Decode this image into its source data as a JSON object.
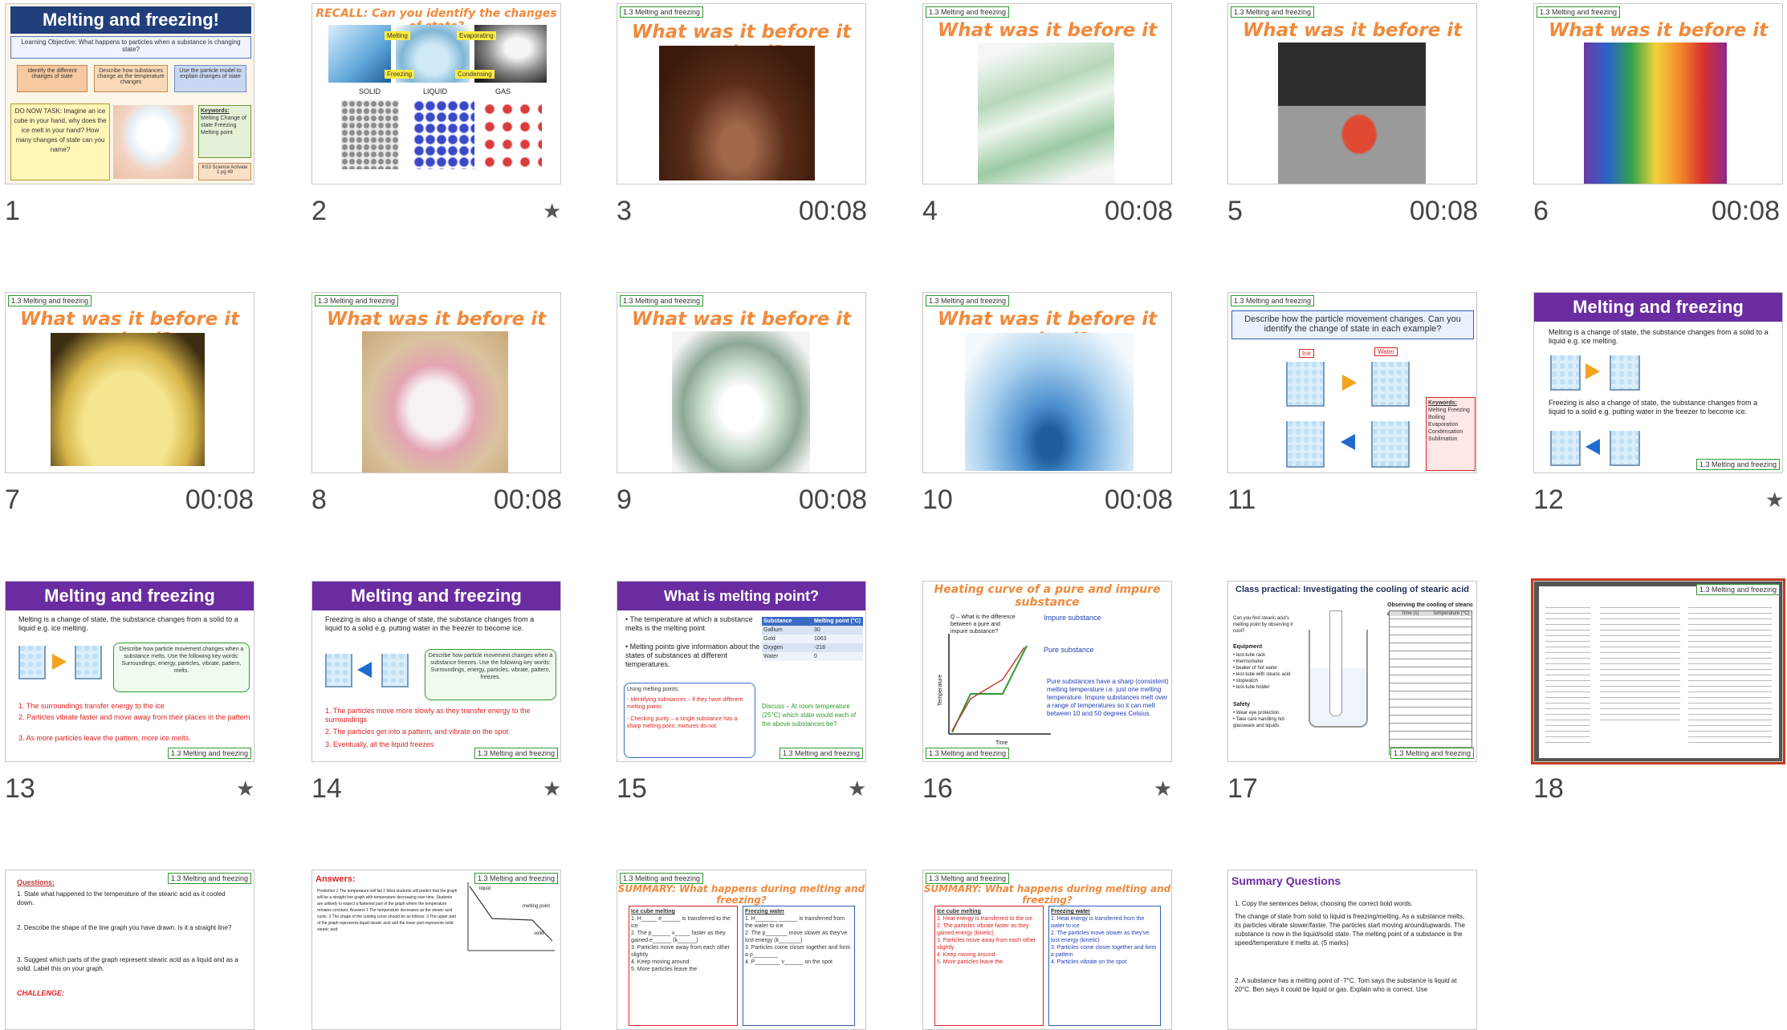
{
  "slides": [
    {
      "number": "1",
      "timing": "",
      "star": "",
      "title": "Melting and freezing!",
      "objective": "Learning Objective: What happens to particles when a substance is changing state?",
      "boxes": [
        "Identify the different changes of state",
        "Describe how substances change as the temperature changes",
        "Use the particle model to explain changes of state"
      ],
      "do_now": "DO NOW TASK: Imagine an ice cube in your hand, why does the ice melt in your hand? How many changes of state can you name?",
      "keywords_title": "Keywords:",
      "keywords": "Melting Change of state Freezing Melting point",
      "footer": "KS3 Science Activate 1 pg 49"
    },
    {
      "number": "2",
      "timing": "",
      "star": "★",
      "title": "RECALL: Can you identify the changes of state?",
      "labels": [
        "Melting",
        "Evaporating",
        "Freezing",
        "Condensing"
      ],
      "states": [
        "SOLID",
        "LIQUID",
        "GAS"
      ]
    },
    {
      "number": "3",
      "timing": "00:08",
      "star": "",
      "tag": "1.3 Melting and freezing",
      "title": "What was it before it melted?"
    },
    {
      "number": "4",
      "timing": "00:08",
      "star": "",
      "tag": "1.3 Melting and freezing",
      "title": "What was it before it melted?"
    },
    {
      "number": "5",
      "timing": "00:08",
      "star": "",
      "tag": "1.3 Melting and freezing",
      "title": "What was it before it melted?"
    },
    {
      "number": "6",
      "timing": "00:08",
      "star": "",
      "tag": "1.3 Melting and freezing",
      "title": "What was it before it melted?"
    },
    {
      "number": "7",
      "timing": "00:08",
      "star": "",
      "tag": "1.3 Melting and freezing",
      "title": "What was it before it melted?"
    },
    {
      "number": "8",
      "timing": "00:08",
      "star": "",
      "tag": "1.3 Melting and freezing",
      "title": "What was it before it melted?"
    },
    {
      "number": "9",
      "timing": "00:08",
      "star": "",
      "tag": "1.3 Melting and freezing",
      "title": "What was it before it melted?"
    },
    {
      "number": "10",
      "timing": "00:08",
      "star": "",
      "tag": "1.3 Melting and freezing",
      "title": "What was it before it melted?"
    },
    {
      "number": "11",
      "timing": "",
      "star": "",
      "tag": "1.3 Melting and freezing",
      "title": "Describe how the particle movement changes. Can you identify the change of state in each example?",
      "ice": "Ice",
      "water": "Water",
      "keywords_title": "Keywords:",
      "keywords": "Melting Freezing Boiling Evaporation Condensation Sublimation"
    },
    {
      "number": "12",
      "timing": "",
      "star": "★",
      "title": "Melting and freezing",
      "text1": "Melting is a change of state, the substance changes from a solid to a liquid e.g. ice melting.",
      "text2": "Freezing is also a change of state, the substance changes from a liquid to a solid e.g. putting water in the freezer to become ice.",
      "tag": "1.3 Melting and freezing"
    },
    {
      "number": "13",
      "timing": "",
      "star": "★",
      "title": "Melting and freezing",
      "text1": "Melting is a change of state, the substance changes from a solid to a liquid e.g. ice melting.",
      "green": "Describe how particle movement changes when a substance melts. Use the following key words: Surroundings, energy, particles, vibrate, pattern, melts.",
      "steps": [
        "1. The surroundings transfer energy to the ice",
        "2. Particles vibrate faster and move away from their places in the pattern",
        "3. As more particles leave the pattern, more ice melts."
      ],
      "tag": "1.3 Melting and freezing"
    },
    {
      "number": "14",
      "timing": "",
      "star": "★",
      "title": "Melting and freezing",
      "text1": "Freezing is also a change of state, the substance changes from a liquid to a solid e.g. putting water in the freezer to become ice.",
      "green": "Describe how particle movement changes when a substance freezes. Use the following key words: Surroundings, energy, particles, vibrate, pattern, freezes.",
      "steps": [
        "1. The particles move more slowly as they transfer energy to the surroundings",
        "2. The particles get into a pattern, and vibrate on the spot",
        "3. Eventually, all the liquid freezes"
      ],
      "tag": "1.3 Melting and freezing"
    },
    {
      "number": "15",
      "timing": "",
      "star": "★",
      "title": "What is melting point?",
      "bullets": [
        "• The temperature at which a substance melts is the melting point",
        "• Melting points give information about the states of substances at different temperatures."
      ],
      "table_head": [
        "Substance",
        "Melting point (°C)"
      ],
      "table_rows": [
        [
          "Gallium",
          "30"
        ],
        [
          "Gold",
          "1063"
        ],
        [
          "Oxygen",
          "-218"
        ],
        [
          "Water",
          "0"
        ]
      ],
      "uses_title": "Using melting points:",
      "uses": [
        "- Identifying substances – if they have different melting points",
        "- Checking purity – a single substance has a sharp melting point, mixtures do not."
      ],
      "discuss": "Discuss – At room temperature (25°C) which state would each of the above substances be?",
      "tag": "1.3 Melting and freezing"
    },
    {
      "number": "16",
      "timing": "",
      "star": "★",
      "title": "Heating curve of a pure and impure substance",
      "question": "Q – What is the difference between a pure and impure substance?",
      "impure": "Impure substance",
      "pure": "Pure substance",
      "ylabel": "Temperature",
      "xlabel": "Time",
      "explain": "Pure substances have a sharp (consistent) melting temperature i.e. just one melting temperature. Impure substances melt over a range of temperatures so it can melt between 10 and 50 degrees Celsius.",
      "tag": "1.3 Melting and freezing"
    },
    {
      "number": "17",
      "timing": "",
      "star": "",
      "title": "Class practical: Investigating the cooling of stearic acid",
      "subtitle": "Observing the cooling of stearic acid",
      "left_text": "Can you find stearic acid's melting point by observing it cool?",
      "equipment_title": "Equipment",
      "equipment": [
        "• test-tube rack",
        "• thermometer",
        "• beaker of hot water",
        "• test-tube with stearic acid",
        "• stopwatch",
        "• test-tube holder"
      ],
      "safety_title": "Safety",
      "safety": [
        "• Wear eye protection.",
        "• Take care handling hot glassware and liquids."
      ],
      "table_head": [
        "Time (s)",
        "Temperature (°C)"
      ],
      "tag": "1.3 Melting and freezing"
    },
    {
      "number": "18",
      "timing": "",
      "star": "",
      "tag": "1.3 Melting and freezing"
    },
    {
      "number": "",
      "timing": "",
      "star": "",
      "title": "Questions:",
      "tag": "1.3 Melting and freezing",
      "qs": [
        "1. State what happened to the temperature of the stearic acid as it cooled down.",
        "2. Describe the shape of the line graph you have drawn. Is it a straight line?",
        "3. Suggest which parts of the graph represent stearic acid as a liquid and as a solid. Label this on your graph."
      ],
      "challenge": "CHALLENGE:"
    },
    {
      "number": "",
      "timing": "",
      "star": "",
      "title": "Answers:",
      "tag": "1.3 Melting and freezing",
      "ans": "Prediction 1 The temperature will fall 2 Most students will predict that the graph will be a straight line graph with temperature decreasing over time. Students are unlikely to expect a flattened part of the graph where the temperature remains constant. Answers 1 The temperature decreases as the stearic acid cools. 2 The shape of the cooling curve should be as follows: 3 The upper part of the graph represents liquid stearic acid and the lower part represents solid stearic acid.",
      "g_labels": [
        "liquid",
        "melting point",
        "solid"
      ]
    },
    {
      "number": "",
      "timing": "",
      "star": "",
      "tag": "1.3 Melting and freezing",
      "title": "SUMMARY: What happens during melting and freezing?",
      "left_head": "Ice cube melting",
      "right_head": "Freezing water",
      "left": [
        "1. H_____ e______ is transferred to the ice",
        "2. The p______ v_____ faster as they gained e______ (k______)",
        "3. Particles move away from each other slightly",
        "4. Keep moving around",
        "5. More particles leave the"
      ],
      "right": [
        "1. H_______ ______ is transferred from the water to ice",
        "2. The p_______ move slower as they've lost energy (k_______)",
        "3. Particles come closer together and form a p________",
        "4. P________ v______ on the spot"
      ]
    },
    {
      "number": "",
      "timing": "",
      "star": "",
      "tag": "1.3 Melting and freezing",
      "title": "SUMMARY: What happens during melting and freezing?",
      "left_head": "Ice cube melting",
      "right_head": "Freezing water",
      "left": [
        "1. Heat energy is transferred to the ice",
        "2. The particles vibrate faster as they gained energy (kinetic)",
        "3. Particles move away from each other slightly",
        "4. Keep moving around",
        "5. More particles leave the"
      ],
      "right": [
        "1. Heat energy is transferred from the water to ice",
        "2. The particles move slower as they've lost energy (kinetic)",
        "3. Particles come closer together and form a pattern",
        "4. Particles vibrate on the spot"
      ]
    },
    {
      "number": "",
      "timing": "",
      "star": "",
      "title": "Summary Questions",
      "q1": "1. Copy the sentences below, choosing the correct bold words.",
      "q1_text": "The change of state from solid to liquid is freezing/melting. As a substance melts, its particles vibrate slower/faster. The particles start moving around/upwards. The substance is now in the liquid/solid state. The melting point of a substance is the speed/temperature it melts at. (5 marks)",
      "q2": "2. A substance has a melting point of -7°C. Tom says the substance is liquid at 20°C. Ben says it could be liquid or gas. Explain who is correct. Use"
    }
  ]
}
